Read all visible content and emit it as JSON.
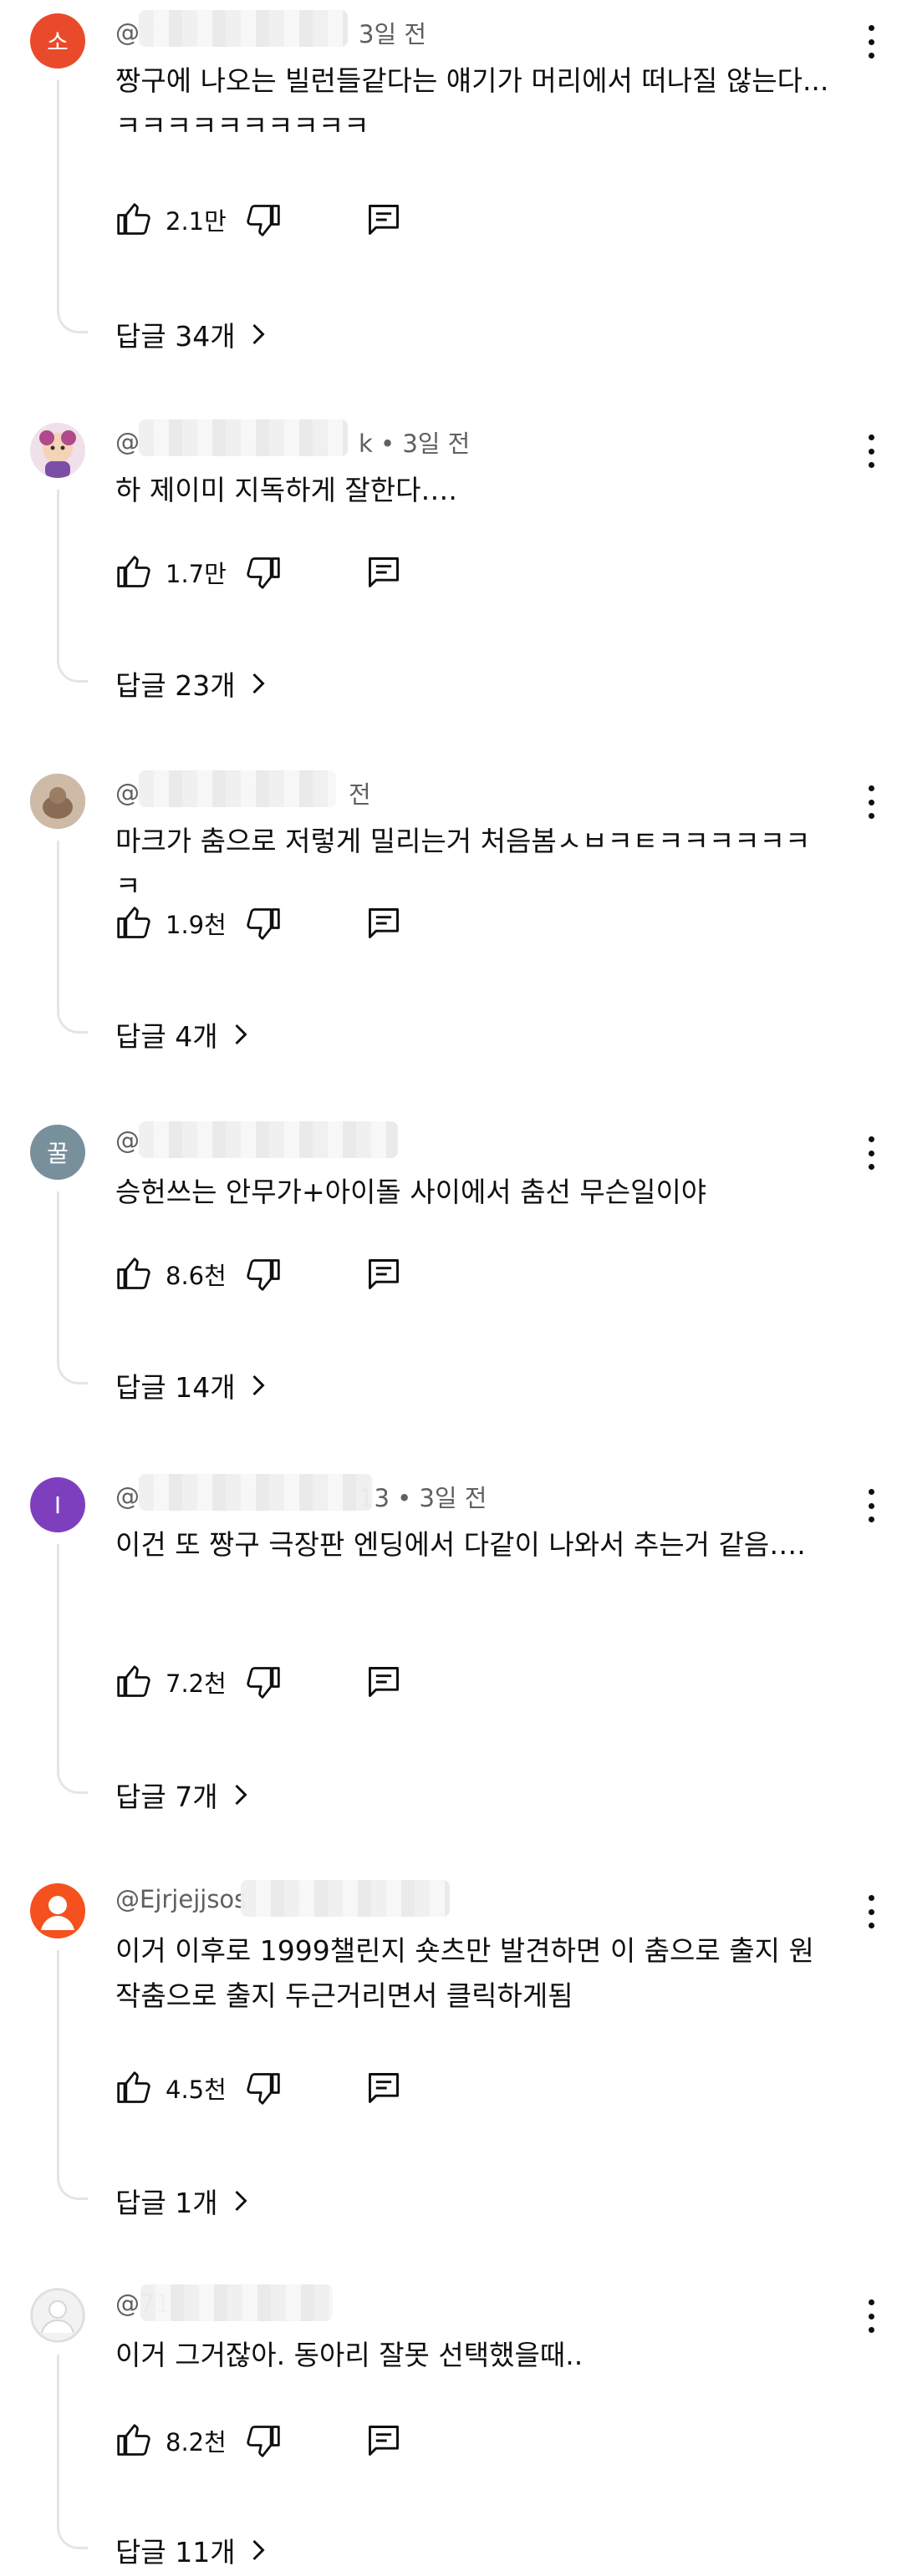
{
  "comments": [
    {
      "avatar_letter": "소",
      "avatar_color": "#ea4a2c",
      "handle": "@",
      "time": "3일 전",
      "text": "짱구에 나오는 빌런들같다는 얘기가 머리에서 떠나질 않는다...ㅋㅋㅋㅋㅋㅋㅋㅋㅋㅋ",
      "likes": "2.1만",
      "replies": "답글 34개"
    },
    {
      "avatar_letter": "",
      "avatar_color": "#e9c8d8",
      "handle": "@",
      "time": "k • 3일 전",
      "text": "하 제이미 지독하게 잘한다….",
      "likes": "1.7만",
      "replies": "답글 23개"
    },
    {
      "avatar_letter": "",
      "avatar_color": "#b49a85",
      "handle": "@",
      "time": "전",
      "text": "마크가 춤으로 저렇게 밀리는거 처음봄ㅅㅂㅋㅌㅋㅋㅋㅋㅋㅋㅋ",
      "likes": "1.9천",
      "replies": "답글 4개"
    },
    {
      "avatar_letter": "꿀",
      "avatar_color": "#78909c",
      "handle": "@",
      "time": "",
      "text": "승헌쓰는 안무가+아이돌 사이에서 춤선 무슨일이야",
      "likes": "8.6천",
      "replies": "답글 14개"
    },
    {
      "avatar_letter": "I",
      "avatar_color": "#7e3fbf",
      "handle": "@",
      "time": "13 • 3일 전",
      "text": "이건 또 짱구 극장판 엔딩에서 다같이 나와서 추는거 같음….",
      "likes": "7.2천",
      "replies": "답글 7개"
    },
    {
      "avatar_letter": "",
      "avatar_color": "#f4511e",
      "handle": "@Ejrjejjsos",
      "time": "",
      "text": "이거 이후로 1999챌린지 숏츠만 발견하면 이 춤으로 출지 원작춤으로 출지 두근거리면서 클릭하게됨",
      "likes": "4.5천",
      "replies": "답글 1개"
    },
    {
      "avatar_letter": "",
      "avatar_color": "#e6e6e6",
      "handle": "@71",
      "time": "",
      "text": "이거 그거잖아. 동아리 잘못 선택했을때..",
      "likes": "8.2천",
      "replies": "답글 11개"
    }
  ],
  "colors": {
    "text": "#0f0f0f",
    "meta": "#606060",
    "thread_line": "#e5e5e5"
  },
  "icons": [
    "thumb-up-icon",
    "thumb-down-icon",
    "reply-icon",
    "chevron-right-icon",
    "more-vert-icon"
  ]
}
